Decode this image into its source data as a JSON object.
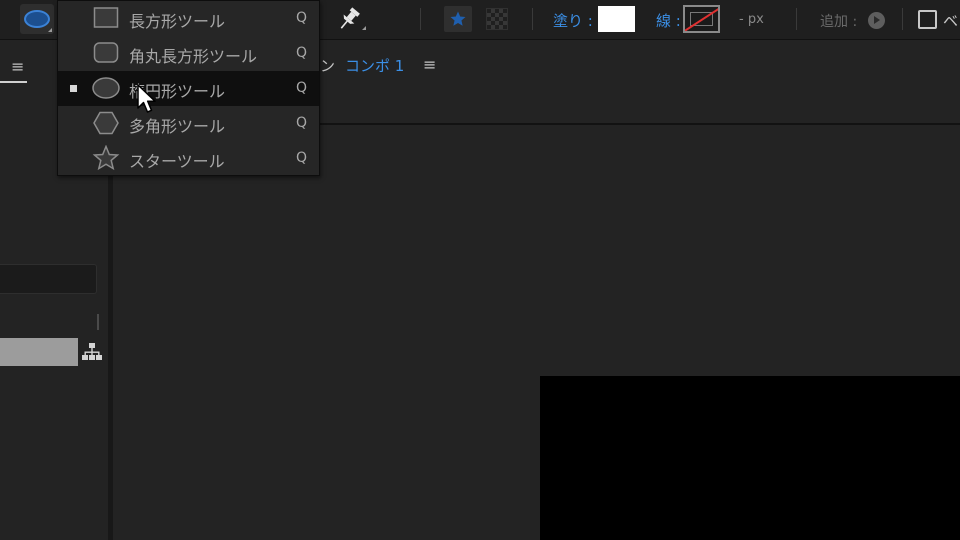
{
  "toolbar": {
    "shape_tool_icon": "ellipse-tool-icon",
    "pin_tool_icon": "puppet-pin-icon",
    "star_icon": "star-icon",
    "fill_label": "塗り :",
    "fill_color": "#ffffff",
    "stroke_label": "線 :",
    "stroke_color": "none",
    "stroke_width": "- px",
    "add_label": "追加 :",
    "checkbox_label": "ベ",
    "accent_color": "#3b8fe6"
  },
  "left_panel": {
    "menu_icon": "≡"
  },
  "comp_panel": {
    "tab_prefix": "ン",
    "tab_name": "コンポ 1",
    "tab_menu_icon": "≡",
    "canvas_color": "#000000"
  },
  "shape_menu": {
    "items": [
      {
        "label": "長方形ツール",
        "shortcut": "Q",
        "icon": "rectangle-icon",
        "selected": false
      },
      {
        "label": "角丸長方形ツール",
        "shortcut": "Q",
        "icon": "rounded-rectangle-icon",
        "selected": false
      },
      {
        "label": "楕円形ツール",
        "shortcut": "Q",
        "icon": "ellipse-icon",
        "selected": true
      },
      {
        "label": "多角形ツール",
        "shortcut": "Q",
        "icon": "polygon-icon",
        "selected": false
      },
      {
        "label": "スターツール",
        "shortcut": "Q",
        "icon": "star-icon",
        "selected": false
      }
    ]
  }
}
